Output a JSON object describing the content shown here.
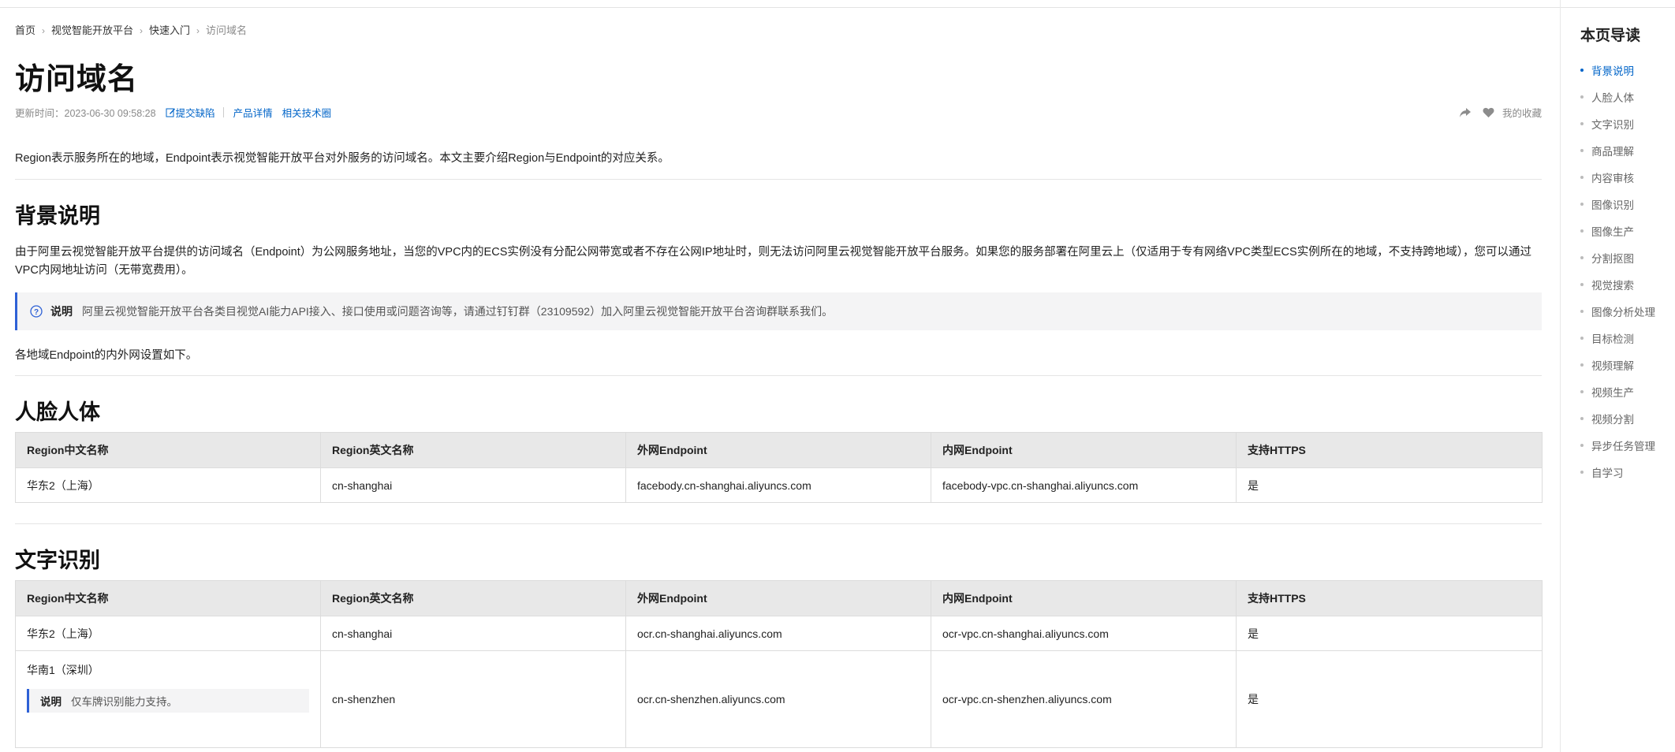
{
  "breadcrumb": {
    "items": [
      "首页",
      "视觉智能开放平台",
      "快速入门"
    ],
    "current": "访问域名",
    "separator": "›"
  },
  "page_title": "访问域名",
  "meta": {
    "updated": "更新时间：2023-06-30 09:58:28",
    "submit_issue": "提交缺陷",
    "product_details": "产品详情",
    "related_circle": "相关技术圈",
    "favorite": "我的收藏"
  },
  "intro": "Region表示服务所在的地域，Endpoint表示视觉智能开放平台对外服务的访问域名。本文主要介绍Region与Endpoint的对应关系。",
  "background": {
    "heading": "背景说明",
    "paragraph": "由于阿里云视觉智能开放平台提供的访问域名（Endpoint）为公网服务地址，当您的VPC内的ECS实例没有分配公网带宽或者不存在公网IP地址时，则无法访问阿里云视觉智能开放平台服务。如果您的服务部署在阿里云上（仅适用于专有网络VPC类型ECS实例所在的地域，不支持跨地域），您可以通过VPC内网地址访问（无带宽费用）。",
    "note_label": "说明",
    "note_text": "阿里云视觉智能开放平台各类目视觉AI能力API接入、接口使用或问题咨询等，请通过钉钉群（23109592）加入阿里云视觉智能开放平台咨询群联系我们。",
    "endpoints_line": "各地域Endpoint的内外网设置如下。"
  },
  "columns": [
    "Region中文名称",
    "Region英文名称",
    "外网Endpoint",
    "内网Endpoint",
    "支持HTTPS"
  ],
  "face": {
    "heading": "人脸人体",
    "rows": [
      [
        "华东2（上海）",
        "cn-shanghai",
        "facebody.cn-shanghai.aliyuncs.com",
        "facebody-vpc.cn-shanghai.aliyuncs.com",
        "是"
      ]
    ]
  },
  "ocr": {
    "heading": "文字识别",
    "rows": [
      [
        "华东2（上海）",
        "cn-shanghai",
        "ocr.cn-shanghai.aliyuncs.com",
        "ocr-vpc.cn-shanghai.aliyuncs.com",
        "是"
      ],
      [
        "华南1（深圳）",
        "cn-shenzhen",
        "ocr.cn-shenzhen.aliyuncs.com",
        "ocr-vpc.cn-shenzhen.aliyuncs.com",
        "是"
      ]
    ],
    "row2_note_label": "说明",
    "row2_note_text": "仅车牌识别能力支持。"
  },
  "toc": {
    "title": "本页导读",
    "items": [
      "背景说明",
      "人脸人体",
      "文字识别",
      "商品理解",
      "内容审核",
      "图像识别",
      "图像生产",
      "分割抠图",
      "视觉搜索",
      "图像分析处理",
      "目标检测",
      "视频理解",
      "视频生产",
      "视频分割",
      "异步任务管理",
      "自学习"
    ],
    "active_index": 0
  },
  "colors": {
    "link": "#0064c8",
    "note_accent": "#2e61d6",
    "table_header_bg": "#e8e8e8",
    "note_bg": "#f4f4f5"
  },
  "icons": [
    "chevron-right-icon",
    "edit-icon",
    "help-circle-icon",
    "share-icon",
    "heart-icon"
  ]
}
